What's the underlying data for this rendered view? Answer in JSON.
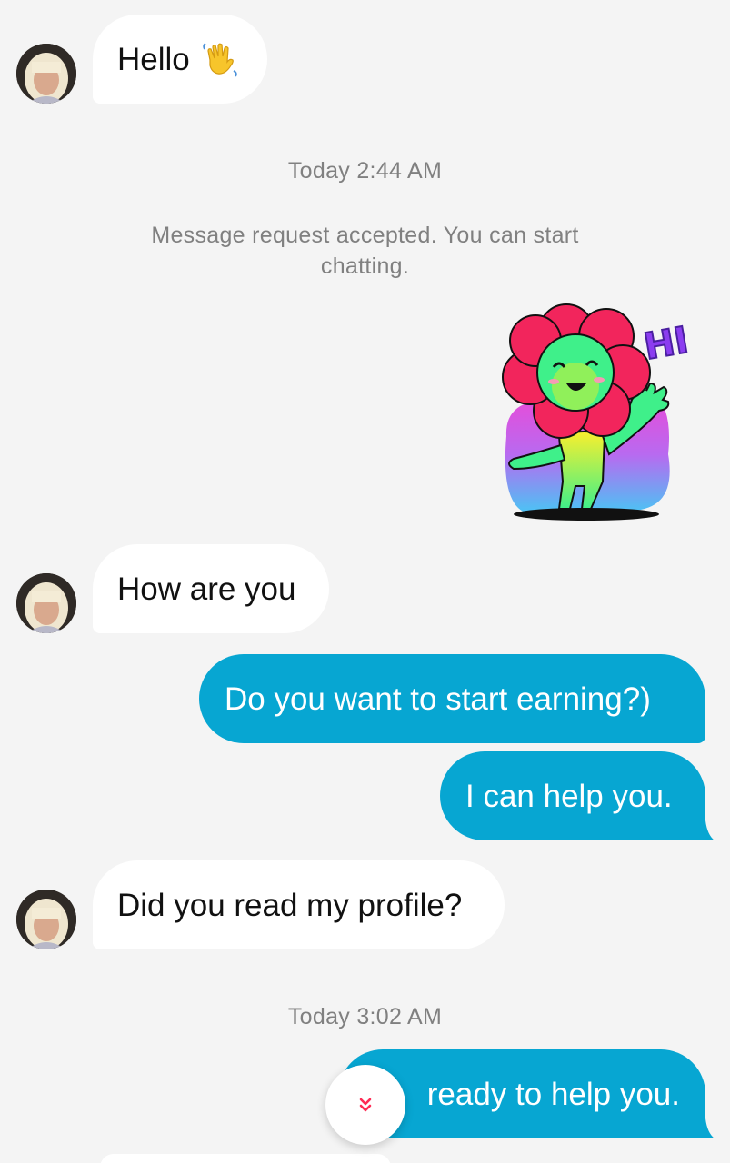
{
  "conversation": {
    "messages": [
      {
        "direction": "incoming",
        "text": "Hello",
        "emoji": "waving-hand-icon"
      },
      {
        "type": "timestamp",
        "text": "Today 2:44 AM"
      },
      {
        "type": "system",
        "text": "Message request accepted. You can start chatting."
      },
      {
        "direction": "outgoing",
        "type": "sticker",
        "sticker_text": "HI",
        "sticker": "flower-waving-sticker"
      },
      {
        "direction": "incoming",
        "text": "How are you"
      },
      {
        "direction": "outgoing",
        "text": "Do you want to start earning?)"
      },
      {
        "direction": "outgoing",
        "text": "I can help you."
      },
      {
        "direction": "incoming",
        "text": "Did you read my profile?"
      },
      {
        "type": "timestamp",
        "text": "Today 3:02 AM"
      },
      {
        "direction": "outgoing",
        "text": "ready to help you."
      }
    ]
  },
  "scroll_button": {
    "icon": "double-chevron-down-icon"
  },
  "colors": {
    "background": "#f4f4f4",
    "incoming_bubble": "#ffffff",
    "outgoing_bubble": "#07a6d2",
    "meta_text": "#808080",
    "accent": "#fe2c55"
  }
}
